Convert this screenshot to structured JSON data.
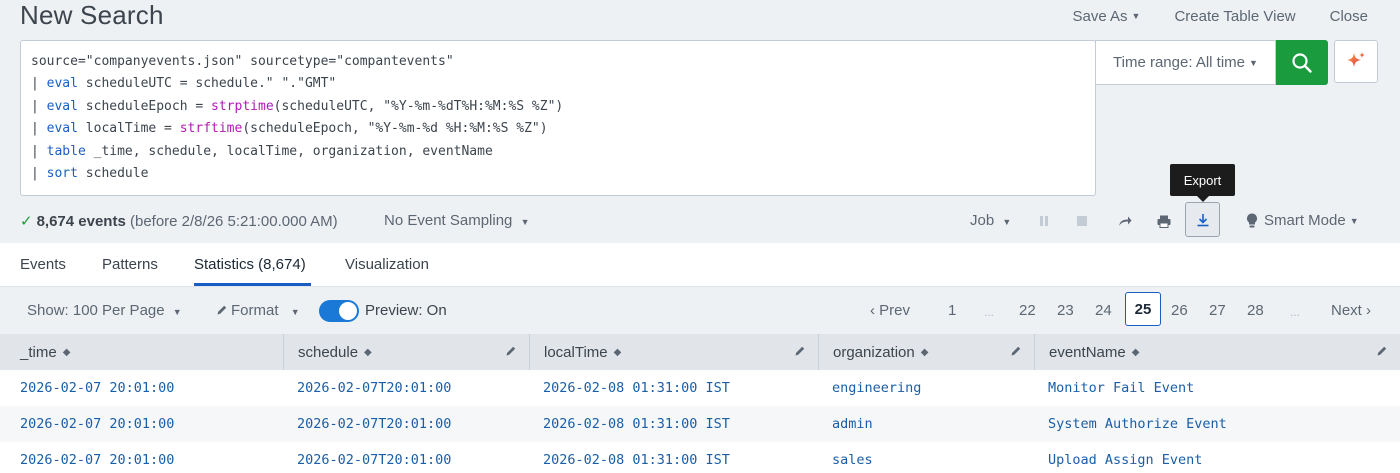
{
  "header": {
    "title": "New Search",
    "save_as": "Save As",
    "create_table_view": "Create Table View",
    "close": "Close"
  },
  "search": {
    "line1": "source=\"companyevents.json\" sourcetype=\"compantevents\"",
    "line2": {
      "pipe": "| ",
      "cmd": "eval",
      "rest": " scheduleUTC = schedule.\" \".\"GMT\""
    },
    "line3": {
      "pipe": "| ",
      "cmd": "eval",
      "mid": " scheduleEpoch = ",
      "fn": "strptime",
      "rest": "(scheduleUTC, \"%Y-%m-%dT%H:%M:%S %Z\")"
    },
    "line4": {
      "pipe": "| ",
      "cmd": "eval",
      "mid": " localTime = ",
      "fn": "strftime",
      "rest": "(scheduleEpoch, \"%Y-%m-%d %H:%M:%S %Z\")"
    },
    "line5": {
      "pipe": "| ",
      "cmd": "table",
      "rest": " _time, schedule, localTime, organization, eventName"
    },
    "line6": {
      "pipe": "| ",
      "cmd": "sort",
      "rest": " schedule"
    },
    "time_range": "Time range: All time"
  },
  "tooltip": "Export",
  "status": {
    "count": "8,674 events",
    "before": " (before 2/8/26 5:21:00.000 AM)",
    "sampling": "No Event Sampling",
    "job": "Job",
    "mode": "Smart Mode"
  },
  "tabs": [
    {
      "label": "Events"
    },
    {
      "label": "Patterns"
    },
    {
      "label": "Statistics (8,674)"
    },
    {
      "label": "Visualization"
    }
  ],
  "controls": {
    "show": "Show: 100 Per Page",
    "format": "Format",
    "preview": "Preview: On"
  },
  "pager": {
    "prev": "Prev",
    "pages": [
      "1",
      "...",
      "22",
      "23",
      "24",
      "25",
      "26",
      "27",
      "28",
      "..."
    ],
    "current": "25",
    "next": "Next"
  },
  "table": {
    "columns": [
      "_time",
      "schedule",
      "localTime",
      "organization",
      "eventName"
    ],
    "rows": [
      [
        "2026-02-07 20:01:00",
        "2026-02-07T20:01:00",
        "2026-02-08 01:31:00 IST",
        "engineering",
        "Monitor Fail Event"
      ],
      [
        "2026-02-07 20:01:00",
        "2026-02-07T20:01:00",
        "2026-02-08 01:31:00 IST",
        "admin",
        "System Authorize Event"
      ],
      [
        "2026-02-07 20:01:00",
        "2026-02-07T20:01:00",
        "2026-02-08 01:31:00 IST",
        "sales",
        "Upload Assign Event"
      ]
    ]
  },
  "colors": {
    "accent": "#1a5ec5",
    "search_button": "#1a9c3e",
    "toggle": "#1a79d6",
    "link": "#1a5ea8",
    "function": "#b21ab5"
  }
}
